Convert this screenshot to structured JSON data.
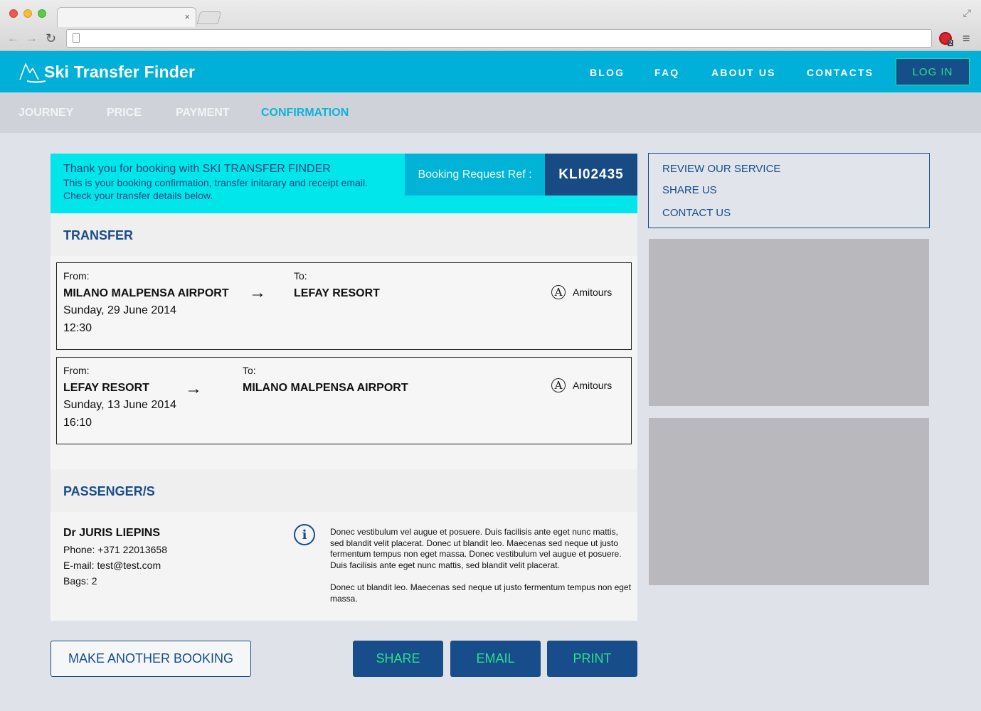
{
  "browser": {
    "tab_title": "",
    "tab_close": "×",
    "url": ""
  },
  "site": {
    "logo_text": "Ski Transfer Finder",
    "nav": [
      "BLOG",
      "FAQ",
      "ABOUT US",
      "CONTACTS"
    ],
    "login_label": "LOG IN"
  },
  "steps": {
    "items": [
      "JOURNEY",
      "PRICE",
      "PAYMENT",
      "CONFIRMATION"
    ],
    "active": "CONFIRMATION"
  },
  "thanks": {
    "title": "Thank you  for booking with SKI TRANSFER FINDER",
    "line1": "This is your booking confirmation, transfer initarary and receipt email.",
    "line2": "Check your transfer details below.",
    "ref_label": "Booking Request Ref :",
    "ref_code": "KLI02435"
  },
  "transfer": {
    "heading": "TRANSFER",
    "from_label": "From:",
    "to_label": "To:",
    "legs": [
      {
        "from": "MILANO MALPENSA AIRPORT",
        "to": "LEFAY RESORT",
        "date": "Sunday, 29 June 2014",
        "time": "12:30",
        "operator": "Amitours"
      },
      {
        "from": "LEFAY RESORT",
        "to": "MILANO MALPENSA AIRPORT",
        "date": "Sunday, 13 June 2014",
        "time": "16:10",
        "operator": "Amitours"
      }
    ]
  },
  "passenger": {
    "heading": "PASSENGER/S",
    "name": "Dr JURIS LIEPINS",
    "phone": "Phone: +371 22013658",
    "email": "E-mail: test@test.com",
    "bags": "Bags: 2",
    "info_p1": "Donec vestibulum vel augue et posuere. Duis facilisis ante eget nunc mattis, sed blandit velit placerat. Donec ut blandit leo. Maecenas sed neque ut justo fermentum tempus non eget massa. Donec vestibulum vel augue et posuere. Duis facilisis ante eget nunc mattis, sed blandit velit placerat.",
    "info_p2": "Donec ut blandit leo. Maecenas sed neque ut justo fermentum tempus non eget massa."
  },
  "actions": {
    "another": "MAKE ANOTHER BOOKING",
    "share": "SHARE",
    "email": "EMAIL",
    "print": "PRINT"
  },
  "sidebar": {
    "links": [
      "REVIEW OUR SERVICE",
      "SHARE US",
      "CONTACT US"
    ]
  },
  "colors": {
    "header_bg": "#00b0d8",
    "navy": "#174d8a",
    "green_accent": "#2be08d",
    "cyan_banner": "#00e6ea",
    "active_step": "#0fb3d8"
  },
  "icons": {
    "arrow": "→",
    "operator": "A",
    "info": "i",
    "back": "←",
    "forward": "→",
    "reload": "↻",
    "menu": "≡",
    "expand": "⤢"
  }
}
